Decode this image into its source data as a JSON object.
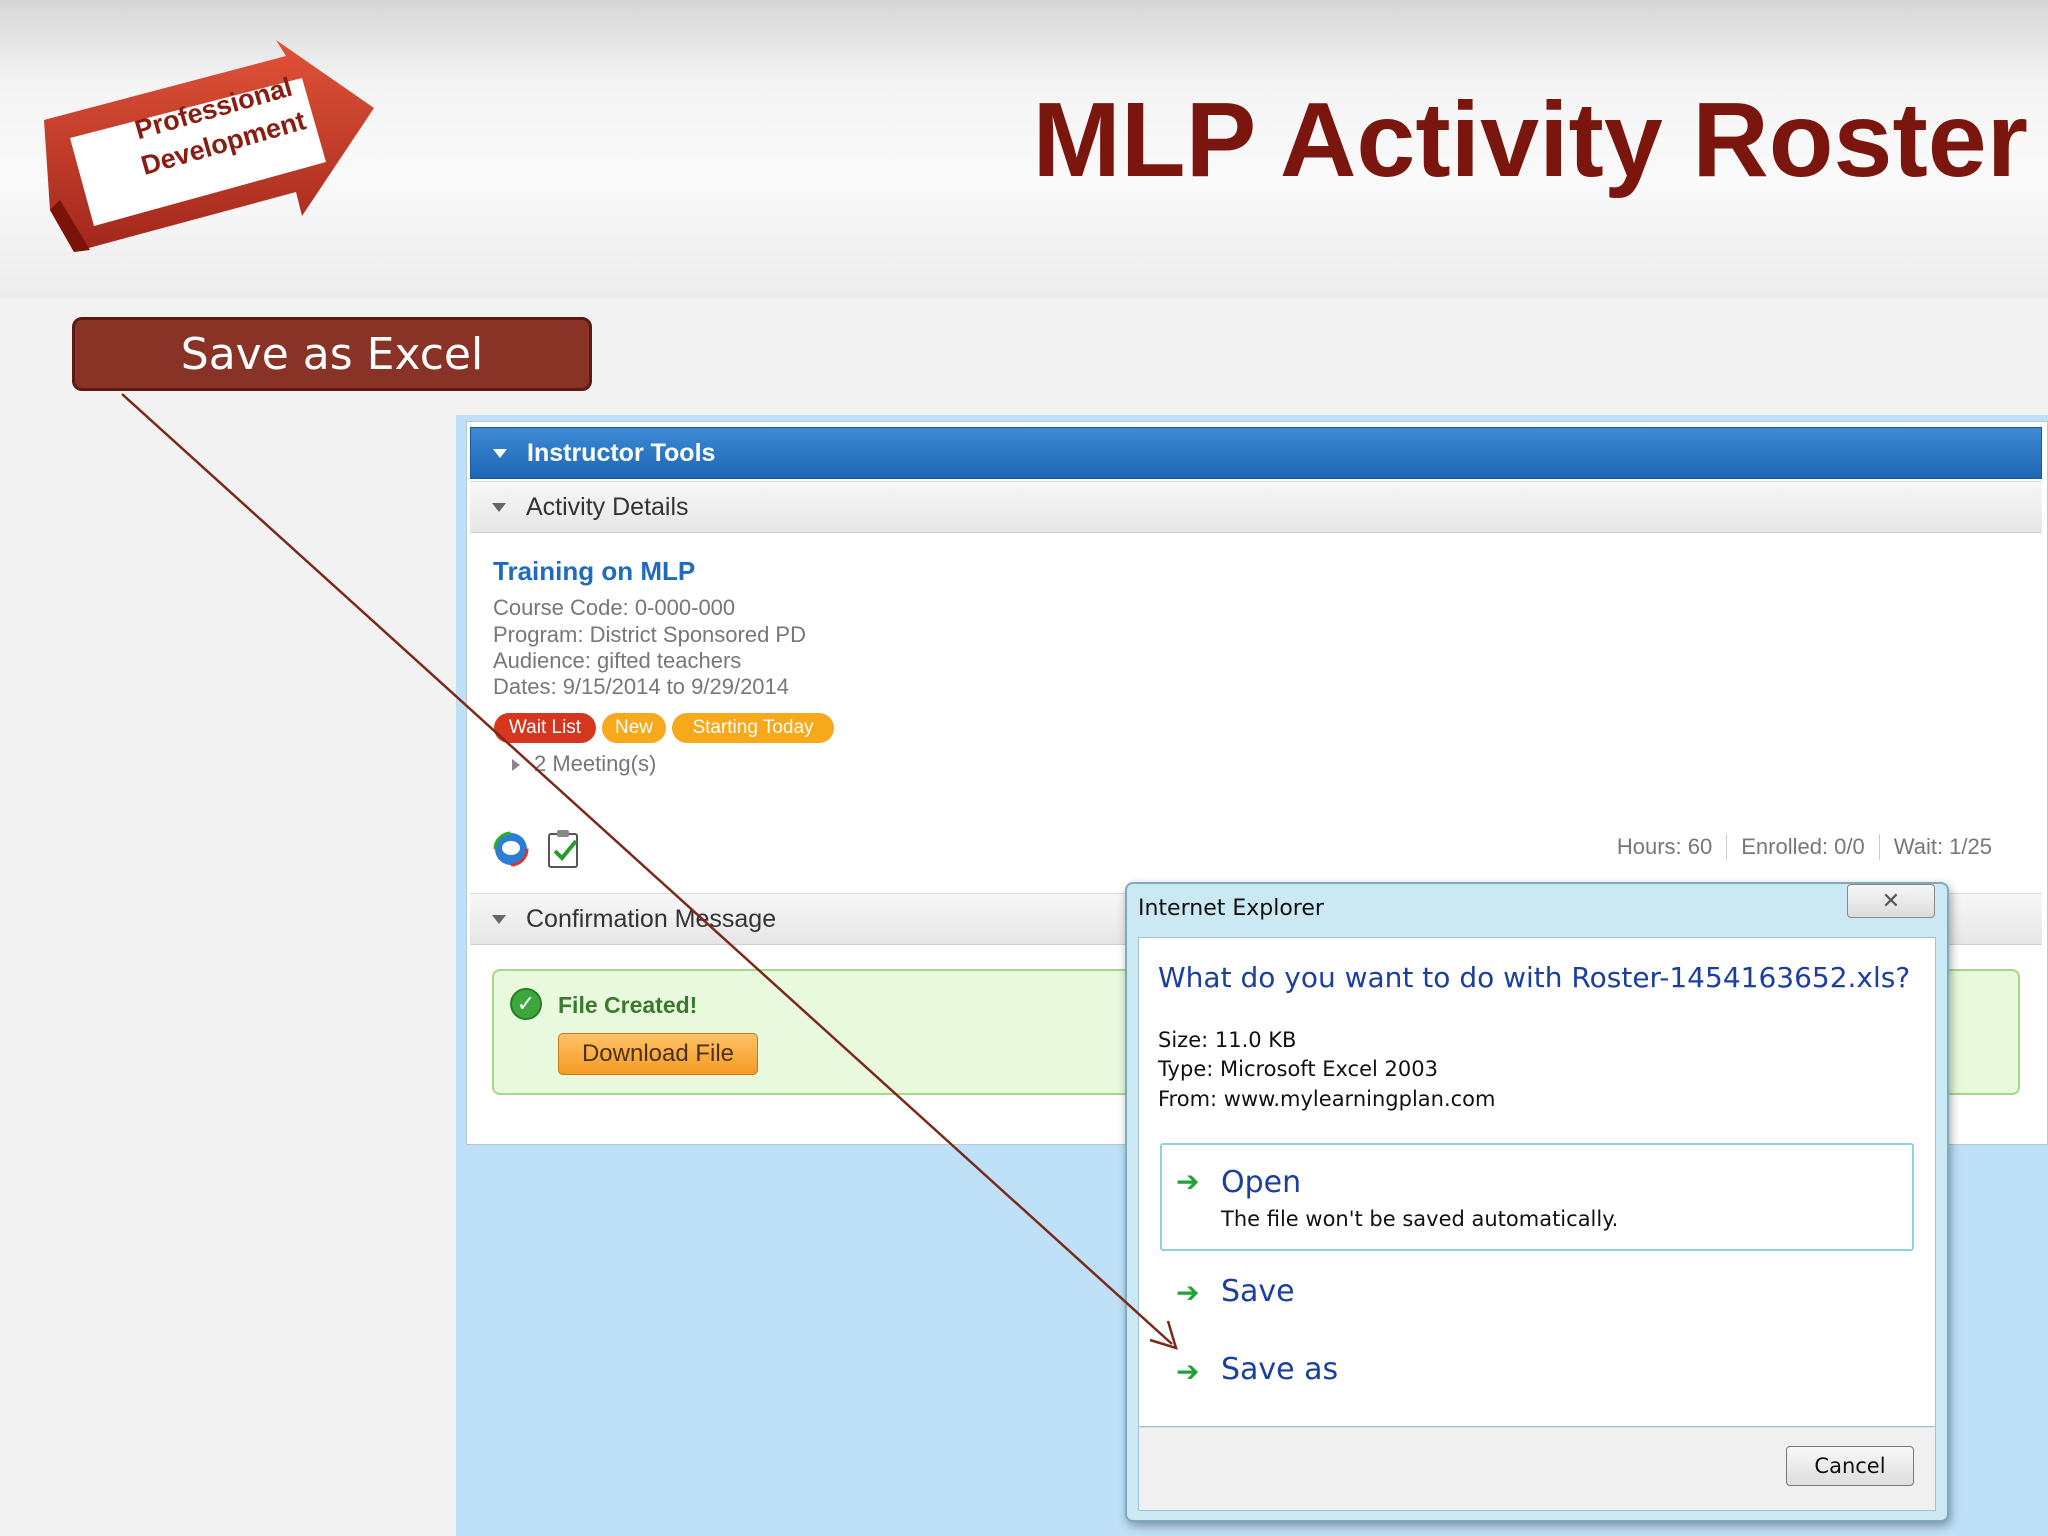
{
  "slide": {
    "title": "MLP Activity Roster",
    "logo_line1": "Professional",
    "logo_line2": "Development",
    "callout": "Save as Excel"
  },
  "app": {
    "instructor_tools": "Instructor Tools",
    "activity_details": "Activity Details",
    "course_title": "Training on MLP",
    "course_code": "Course Code: 0-000-000",
    "program": "Program: District Sponsored PD",
    "audience": "Audience: gifted teachers",
    "dates": "Dates: 9/15/2014 to 9/29/2014",
    "badges": [
      "Wait List",
      "New",
      "Starting Today"
    ],
    "meetings": "2 Meeting(s)",
    "stats": [
      "Hours: 60",
      "Enrolled: 0/0",
      "Wait: 1/25"
    ],
    "confirmation_message": "Confirmation Message",
    "file_created": "File Created!",
    "download_file": "Download File"
  },
  "dialog": {
    "title": "Internet Explorer",
    "question": "What do you want to do with Roster-1454163652.xls?",
    "size": "Size: 11.0 KB",
    "type": "Type: Microsoft Excel 2003",
    "from": "From: www.mylearningplan.com",
    "open_label": "Open",
    "open_sub": "The file won't be saved automatically.",
    "save_label": "Save",
    "save_as_label": "Save as",
    "cancel_label": "Cancel"
  },
  "colors": {
    "title_red": "#7a160d",
    "callout_bg": "#893326",
    "blue_bar": "#1d66b4",
    "badge_red": "#d6361d",
    "badge_orange": "#f7a81b",
    "dialog_blue_text": "#1b3fa0"
  },
  "icons": [
    "arrow-logo-icon",
    "chat-bubble-icon",
    "clipboard-check-icon",
    "check-circle-icon",
    "close-icon",
    "green-arrow-icon"
  ]
}
